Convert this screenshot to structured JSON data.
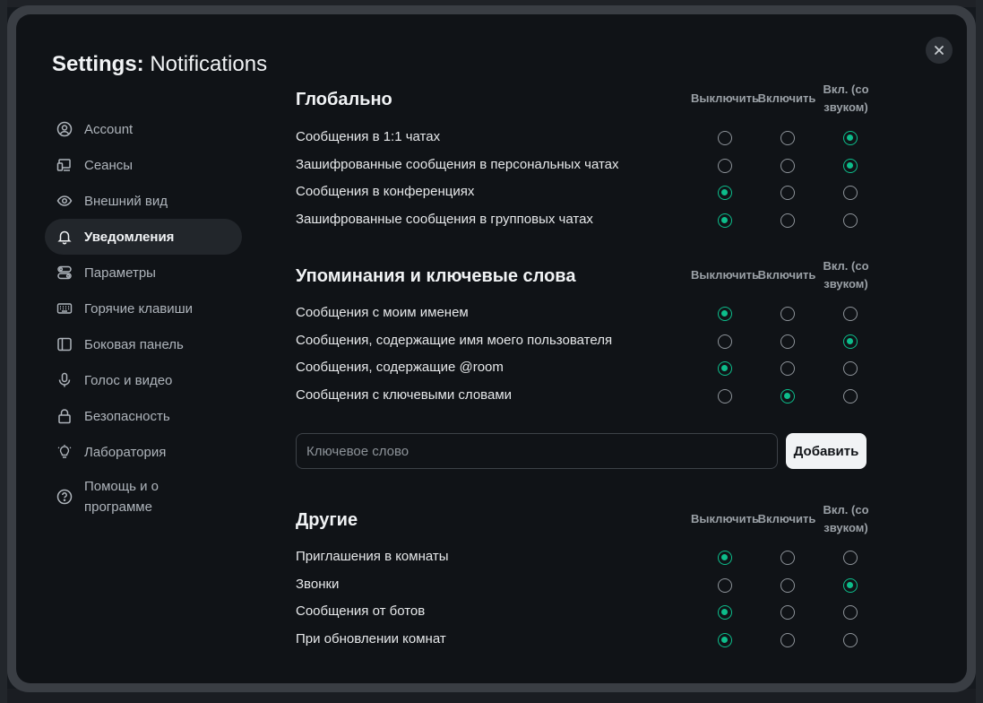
{
  "dialog": {
    "title_prefix": "Settings:",
    "title_page": "Notifications"
  },
  "sidebar": {
    "items": [
      {
        "label": "Account",
        "icon": "user-circle-icon"
      },
      {
        "label": "Сеансы",
        "icon": "devices-icon"
      },
      {
        "label": "Внешний вид",
        "icon": "eye-icon"
      },
      {
        "label": "Уведомления",
        "icon": "bell-icon",
        "active": true
      },
      {
        "label": "Параметры",
        "icon": "toggles-icon"
      },
      {
        "label": "Горячие клавиши",
        "icon": "keyboard-icon"
      },
      {
        "label": "Боковая панель",
        "icon": "sidebar-icon"
      },
      {
        "label": "Голос и видео",
        "icon": "microphone-icon"
      },
      {
        "label": "Безопасность",
        "icon": "lock-icon"
      },
      {
        "label": "Лаборатория",
        "icon": "lightbulb-icon"
      },
      {
        "label": "Помощь и о программе",
        "icon": "help-icon"
      }
    ]
  },
  "columns": {
    "off": "Выключить",
    "on": "Включить",
    "loud": "Вкл. (со звуком)"
  },
  "sections": {
    "global": {
      "title": "Глобально",
      "rows": [
        {
          "label": "Сообщения в 1:1 чатах",
          "selected": "loud"
        },
        {
          "label": "Зашифрованные сообщения в персональных чатах",
          "selected": "loud"
        },
        {
          "label": "Сообщения в конференциях",
          "selected": "off"
        },
        {
          "label": "Зашифрованные сообщения в групповых чатах",
          "selected": "off"
        }
      ]
    },
    "mentions": {
      "title": "Упоминания и ключевые слова",
      "rows": [
        {
          "label": "Сообщения с моим именем",
          "selected": "off"
        },
        {
          "label": "Сообщения, содержащие имя моего пользователя",
          "selected": "loud"
        },
        {
          "label": "Сообщения, содержащие @room",
          "selected": "off"
        },
        {
          "label": "Сообщения с ключевыми словами",
          "selected": "on"
        }
      ]
    },
    "other": {
      "title": "Другие",
      "rows": [
        {
          "label": "Приглашения в комнаты",
          "selected": "off"
        },
        {
          "label": "Звонки",
          "selected": "loud"
        },
        {
          "label": "Сообщения от ботов",
          "selected": "off"
        },
        {
          "label": "При обновлении комнат",
          "selected": "off"
        }
      ]
    }
  },
  "keyword": {
    "placeholder": "Ключевое слово",
    "value": "",
    "add_label": "Добавить"
  },
  "colors": {
    "accent": "#0dbd8b",
    "dialog_bg": "#101317"
  }
}
